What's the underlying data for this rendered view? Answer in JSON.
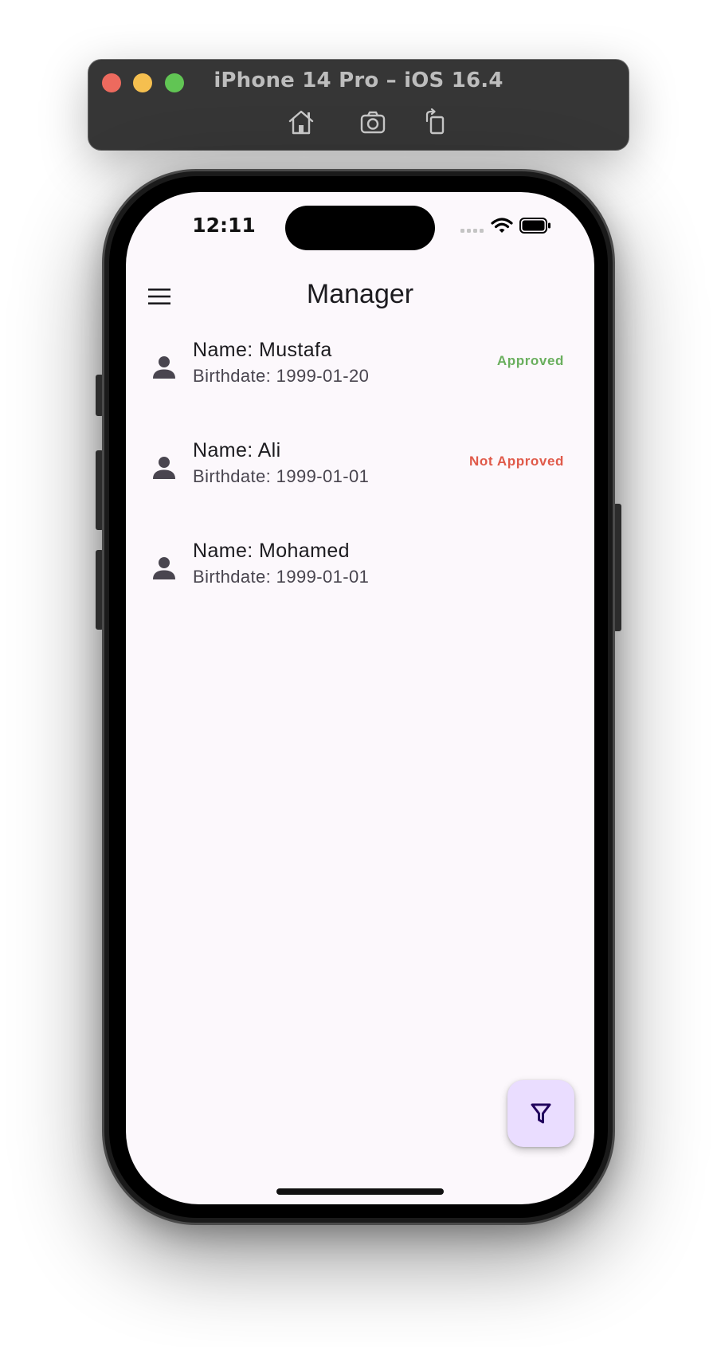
{
  "simulator": {
    "title": "iPhone 14 Pro – iOS 16.4",
    "buttons": [
      "home-icon",
      "screenshot-icon",
      "rotate-icon"
    ]
  },
  "status_bar": {
    "time": "12:11",
    "icons": [
      "signal-icon",
      "wifi-icon",
      "battery-icon"
    ]
  },
  "app_bar": {
    "title": "Manager",
    "leading_icon": "menu-icon"
  },
  "users": [
    {
      "name": "Name: Mustafa",
      "birthdate": "Birthdate: 1999-01-20",
      "status": "Approved"
    },
    {
      "name": "Name: Ali",
      "birthdate": "Birthdate: 1999-01-01",
      "status": "Not Approved"
    },
    {
      "name": "Name: Mohamed",
      "birthdate": "Birthdate: 1999-01-01",
      "status": ""
    }
  ],
  "fab": {
    "icon": "filter-icon"
  },
  "colors": {
    "approved": "#6aaf5e",
    "not_approved": "#e05a4a",
    "fab_background": "#eaddff",
    "screen_background": "#fcf8fc"
  }
}
